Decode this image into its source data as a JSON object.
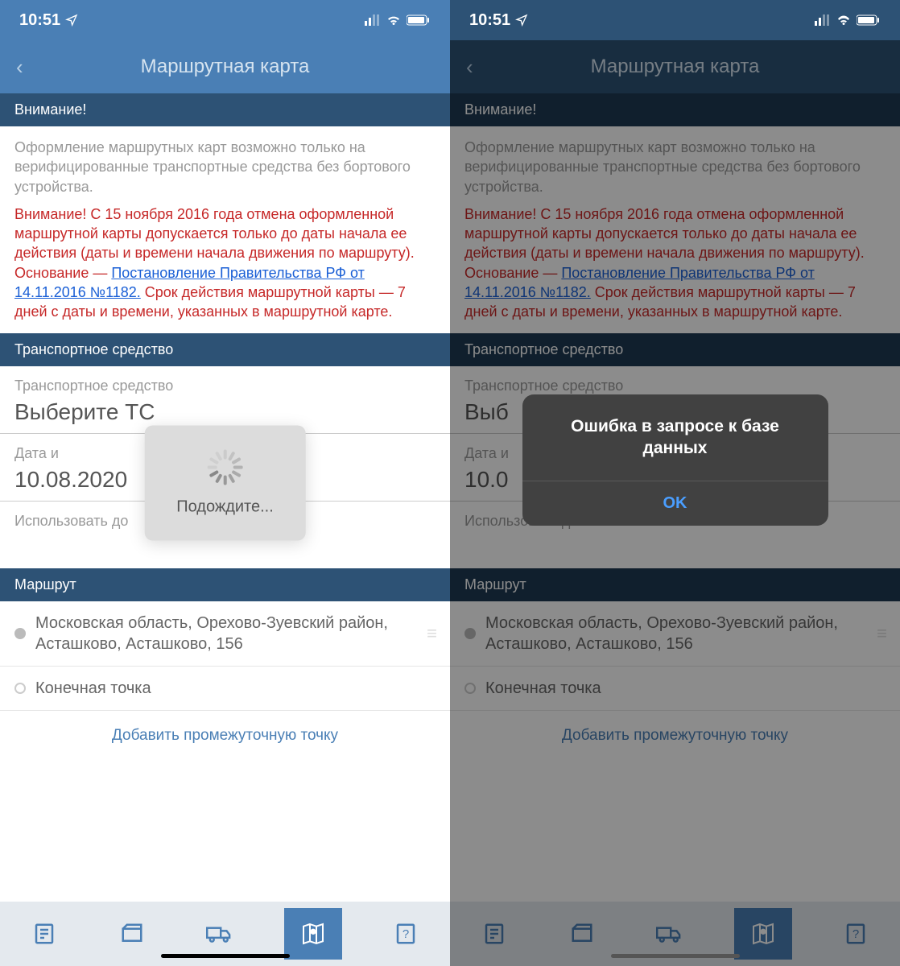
{
  "status": {
    "time": "10:51"
  },
  "nav": {
    "title": "Маршрутная карта"
  },
  "warn": {
    "header": "Внимание!",
    "gray": "Оформление маршрутных карт возможно только на верифицированные транспортные средства без бортового устройства.",
    "red_pre": "Внимание! С 15 ноября 2016 года отмена оформленной маршрутной карты допускается только до даты начала ее действия (даты и времени начала движения по маршруту). Основание — ",
    "link": "Постановление Правительства РФ от 14.11.2016 №1182.",
    "red_post": " Срок действия маршрутной карты — 7 дней с даты и времени, указанных в маршрутной карте."
  },
  "vehicle": {
    "header": "Транспортное средство",
    "field_label": "Транспортное средство",
    "field_value": "Выберите ТС",
    "date_label": "Дата и время начала",
    "date_label_cut": "Дата и",
    "date_value": "10.08.2020",
    "date_value_cut": "10.0",
    "until_label": "Использовать до"
  },
  "route": {
    "header": "Маршрут",
    "start": "Московская область, Орехово-Зуевский район, Асташково, Асташково, 156",
    "end": "Конечная точка",
    "add": "Добавить промежуточную точку"
  },
  "toast": {
    "text": "Подождите..."
  },
  "alert": {
    "message": "Ошибка в запросе к базе данных",
    "ok": "OK"
  }
}
